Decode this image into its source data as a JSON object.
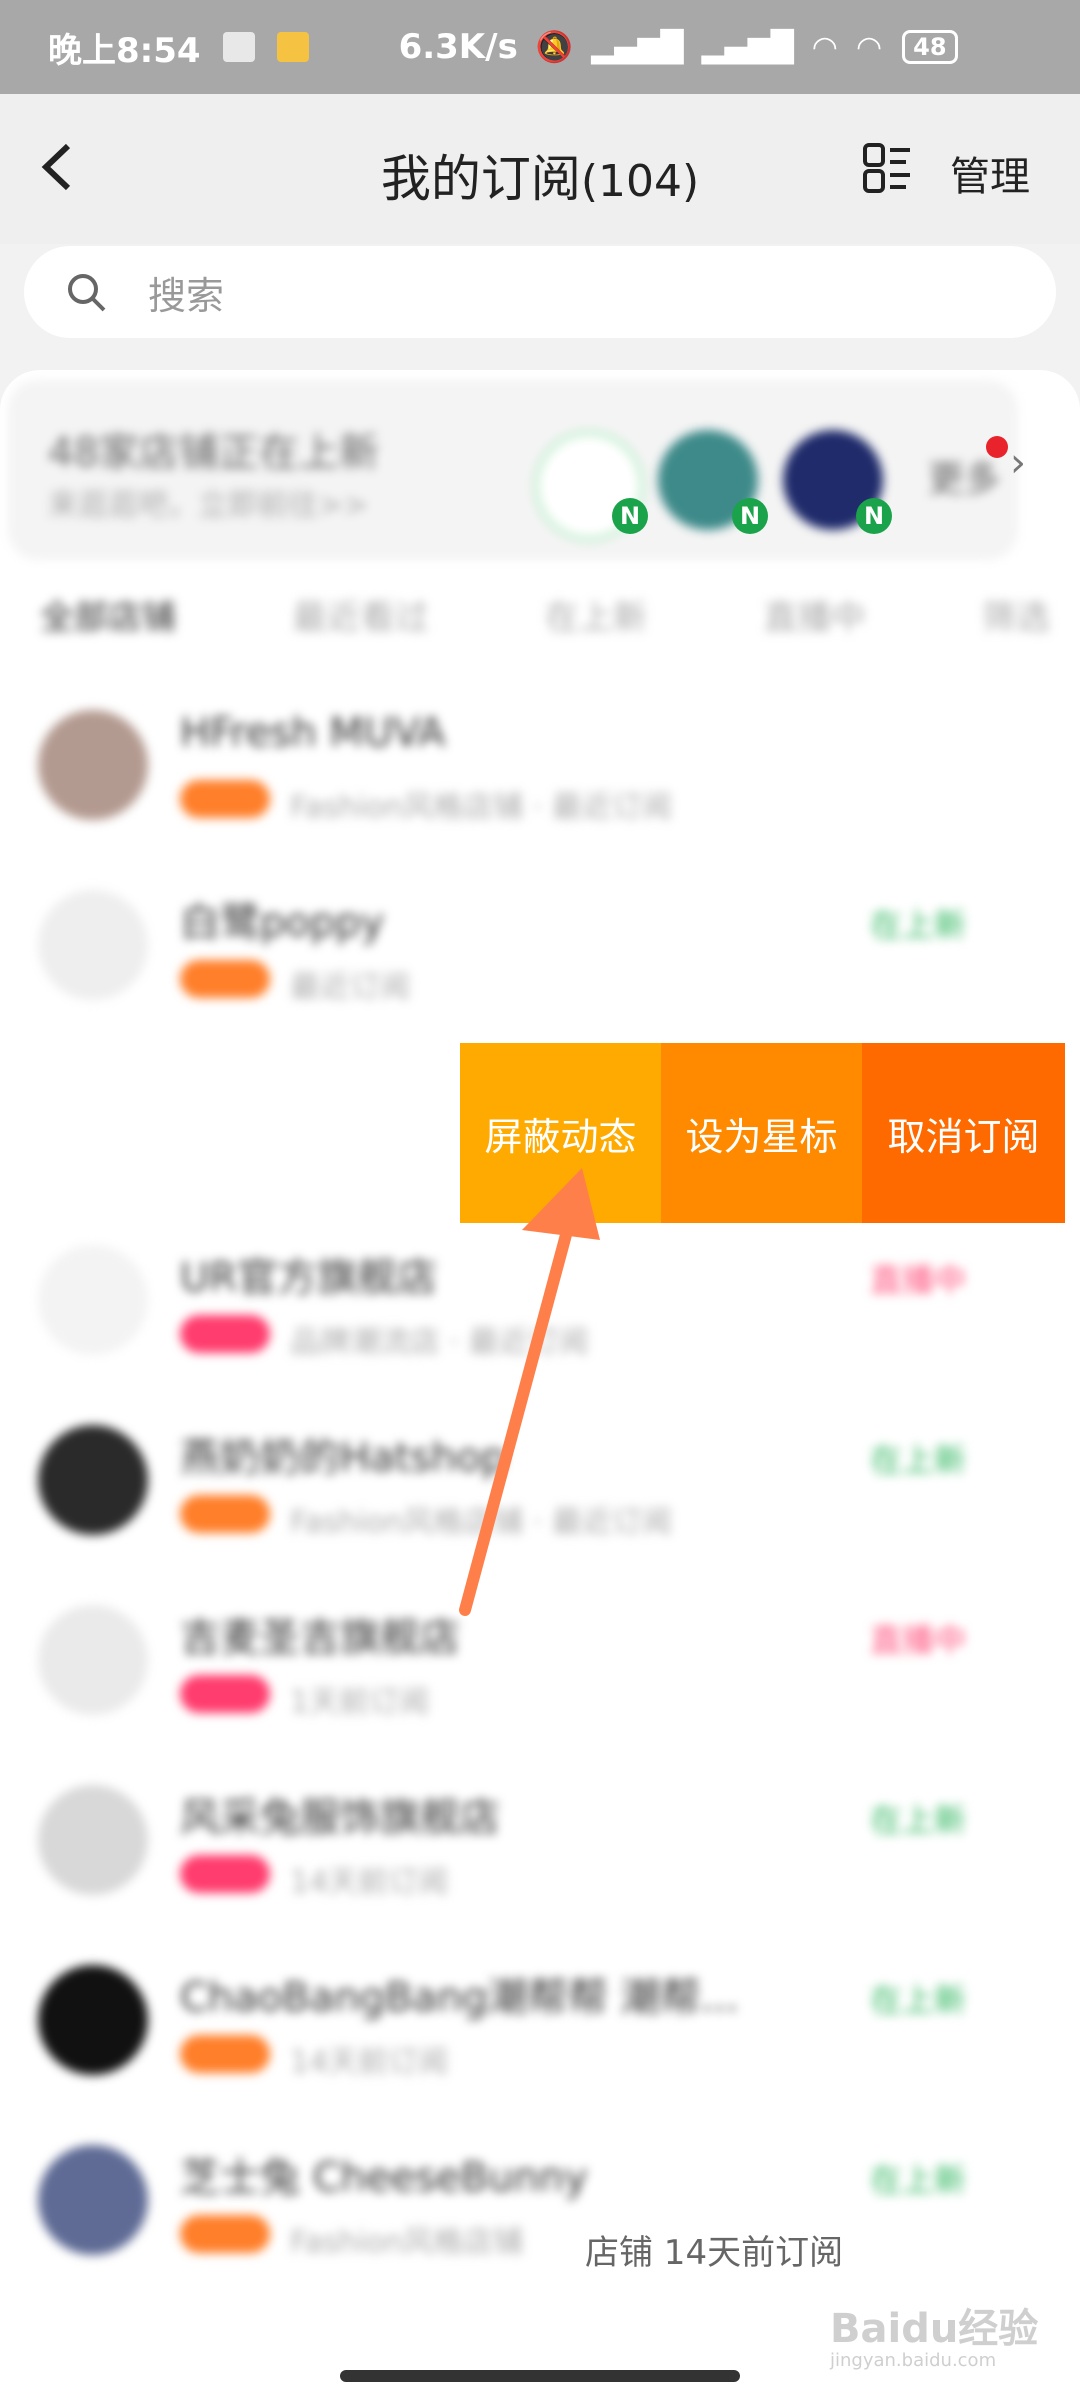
{
  "status_bar": {
    "time": "晚上8:54",
    "speed": "6.3K/s",
    "battery": "48"
  },
  "header": {
    "back_icon": "back-arrow",
    "title": "我的订阅",
    "count": "(104)",
    "manage": "管理"
  },
  "search": {
    "placeholder": "搜索"
  },
  "promo": {
    "line1": "48家店铺正在上新",
    "line2": "来逛逛吧，立即前往>>",
    "more": "更多",
    "badge": "N"
  },
  "tabs": [
    "全部店铺",
    "最近看过",
    "在上新",
    "直播中",
    "筛选"
  ],
  "rows": [
    {
      "name": "HFresh MUVA",
      "sub": "Fashion风格店铺 · 最近订阅",
      "status": ""
    },
    {
      "name": "白鹭poppy",
      "sub": "最近订阅",
      "status": "在上新"
    },
    {
      "name": "UR官方旗舰店",
      "sub": "品牌潮流店 · 最近订阅",
      "status": "直播中"
    },
    {
      "name": "燕奶奶的Hatshop",
      "sub": "Fashion风格店铺 · 最近订阅",
      "status": "在上新"
    },
    {
      "name": "吉麦圣吉旗舰店",
      "sub": "1天前订阅",
      "status": "直播中"
    },
    {
      "name": "风采兔服饰旗舰店",
      "sub": "14天前订阅",
      "status": "在上新"
    },
    {
      "name": "ChaoBangBang潮帮帮 潮帮...",
      "sub": "14天前订阅",
      "status": "在上新"
    },
    {
      "name": "芝士兔 CheeseBunny",
      "sub": "Fashion风格店铺",
      "status": "在上新"
    }
  ],
  "swipe_actions": {
    "mute": "屏蔽动态",
    "star": "设为星标",
    "unsubscribe": "取消订阅"
  },
  "bottom_sub_text": "店铺 14天前订阅",
  "watermark": {
    "brand": "Baidu经验",
    "url": "jingyan.baidu.com"
  },
  "colors": {
    "mute": "#ffaa00",
    "star": "#ff8a00",
    "unsubscribe": "#ff6a00",
    "arrow": "#ff7f4a"
  }
}
